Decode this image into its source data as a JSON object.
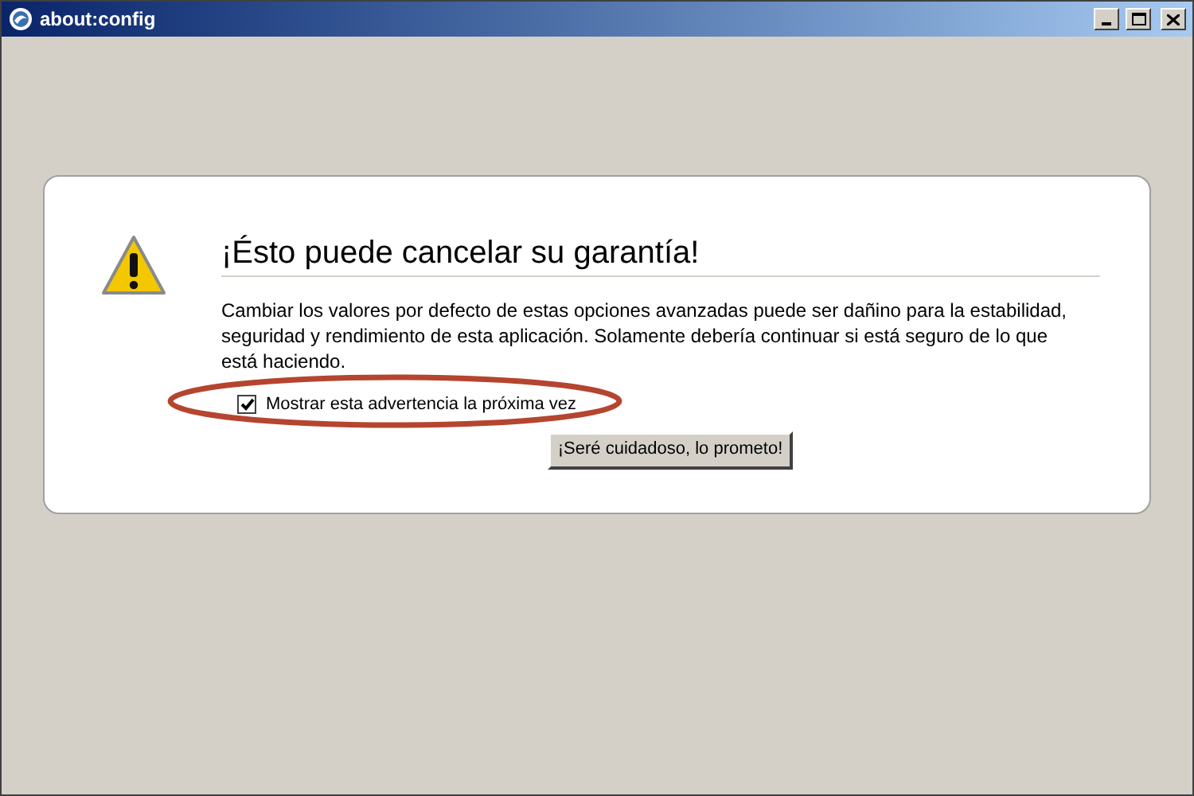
{
  "window": {
    "title": "about:config"
  },
  "warning": {
    "heading": "¡Ésto puede cancelar su garantía!",
    "message": "Cambiar los valores por defecto de estas opciones avanzadas puede ser dañino para la estabilidad, seguridad y rendimiento de esta aplicación. Solamente debería continuar si está seguro de lo que está haciendo.",
    "checkbox": {
      "label": "Mostrar esta advertencia la próxima vez",
      "checked": true
    },
    "button": "¡Seré cuidadoso, lo prometo!"
  }
}
